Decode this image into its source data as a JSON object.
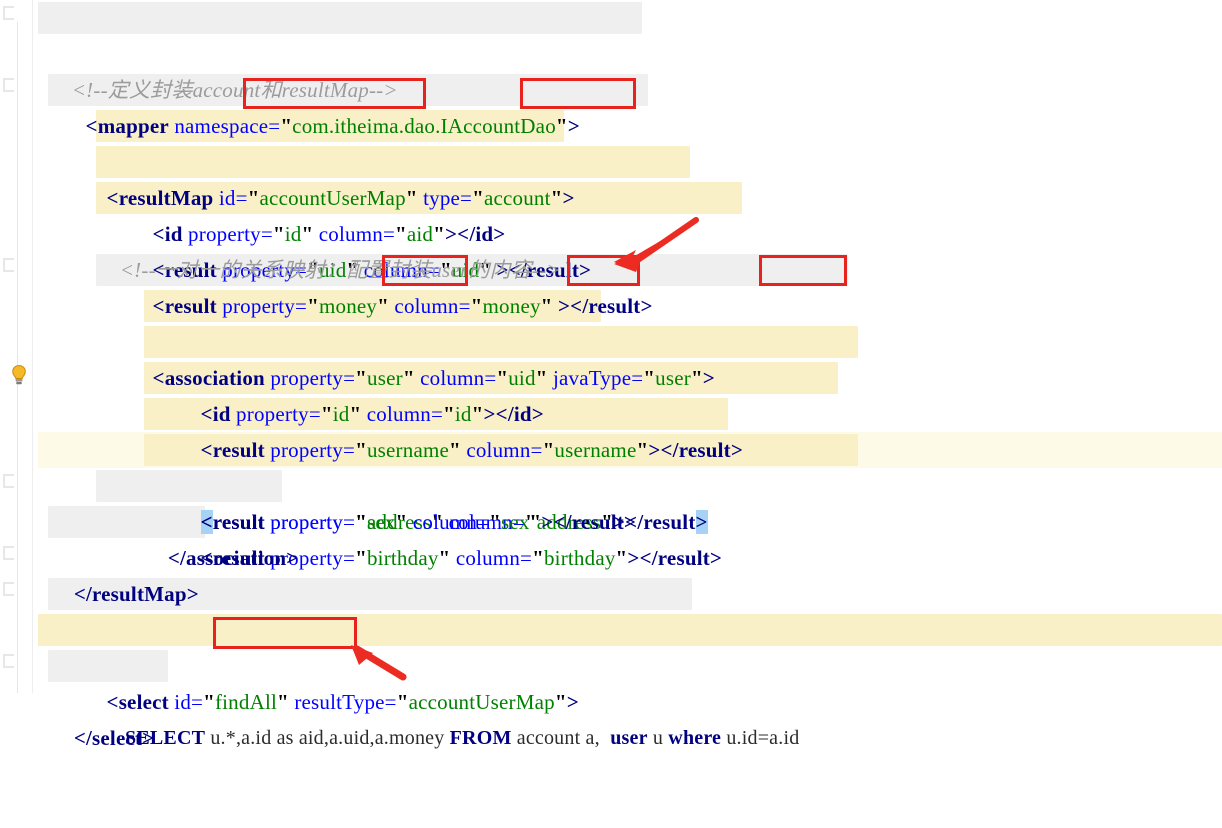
{
  "editor": {
    "language": "xml",
    "file_kind": "MyBatis mapper XML",
    "colors": {
      "background": "#ffffff",
      "tag": "#000080",
      "attribute": "#0000ff",
      "string": "#008000",
      "comment": "#9b9b9b",
      "current_line_band": "#fdfae7",
      "scope_highlight_cream": "#faf0c8",
      "scope_highlight_gray": "#efefef",
      "bracket_match": "#a6d2f5",
      "annotation_red": "#e8231e"
    },
    "gutter": {
      "bulb_icon": "lightbulb-icon",
      "bulb_line_index": 10,
      "fold_marker_icon": "code-fold-marker-icon"
    }
  },
  "lines": [
    {
      "i": 0,
      "text": "<mapper namespace=\"com.itheima.dao.IAccountDao\">"
    },
    {
      "i": 1,
      "text": "<!--定义封装account和resultMap-->"
    },
    {
      "i": 2,
      "text": "<resultMap id=\"accountUserMap\" type=\"account\">"
    },
    {
      "i": 3,
      "text": "<id property=\"id\" column=\"aid\"></id>"
    },
    {
      "i": 4,
      "text": "<result property=\"uid\" column=\"uid\" ></result>"
    },
    {
      "i": 5,
      "text": "<result property=\"money\" column=\"money\" ></result>"
    },
    {
      "i": 6,
      "text": "<!--一对一的关系映射：配置封装user的内容-->"
    },
    {
      "i": 7,
      "text": "<association property=\"user\" column=\"uid\" javaType=\"user\">"
    },
    {
      "i": 8,
      "text": "<id property=\"id\" column=\"id\"></id>"
    },
    {
      "i": 9,
      "text": "<result property=\"username\" column=\"username\"></result>"
    },
    {
      "i": 10,
      "text": "<result property=\"address\" column=\"address\"></result>"
    },
    {
      "i": 11,
      "text": "<result property=\"sex\" column=\"sex\"></result>"
    },
    {
      "i": 12,
      "text": "<result property=\"birthday\" column=\"birthday\"></result>"
    },
    {
      "i": 13,
      "text": "</association>"
    },
    {
      "i": 14,
      "text": "</resultMap>"
    },
    {
      "i": 15,
      "text": ""
    },
    {
      "i": 16,
      "text": "<select id=\"findAll\" resultType=\"accountUserMap\">"
    },
    {
      "i": 17,
      "text": "SELECT u.*,a.id as aid,a.uid,a.money FROM account a,  user u where u.id=a.id"
    },
    {
      "i": 18,
      "text": "</select>"
    }
  ],
  "tokens": {
    "l0": {
      "open": "<",
      "tag": "mapper",
      "attr": " namespace",
      "eq": "=",
      "q1": "\"",
      "val": "com.itheima.dao.IAccountDao",
      "q2": "\"",
      "close": ">"
    },
    "l1": {
      "comment": "<!--定义封装account和resultMap-->"
    },
    "l2": {
      "open": "<",
      "tag": "resultMap",
      "attr1": " id",
      "eq1": "=",
      "q1": "\"",
      "val1": "accountUserMap",
      "q2": "\"",
      "attr2": " type",
      "eq2": "=",
      "q3": "\"",
      "val2": "account",
      "q4": "\"",
      "close": ">"
    },
    "l3": {
      "open": "<",
      "tag": "id",
      "attr1": " property",
      "eq1": "=",
      "q1": "\"",
      "val1": "id",
      "q2": "\"",
      "attr2": " column",
      "eq2": "=",
      "q3": "\"",
      "val2": "aid",
      "q4": "\"",
      "mid": ">",
      "endtag": "</id>"
    },
    "l4": {
      "open": "<",
      "tag": "result",
      "attr1": " property",
      "eq1": "=",
      "q1": "\"",
      "val1": "uid",
      "q2": "\"",
      "attr2": " column",
      "eq2": "=",
      "q3": "\"",
      "val2": "uid",
      "q4": "\"",
      "mid": " >",
      "endtag": "</result>"
    },
    "l5": {
      "open": "<",
      "tag": "result",
      "attr1": " property",
      "eq1": "=",
      "q1": "\"",
      "val1": "money",
      "q2": "\"",
      "attr2": " column",
      "eq2": "=",
      "q3": "\"",
      "val2": "money",
      "q4": "\"",
      "mid": " >",
      "endtag": "</result>"
    },
    "l6": {
      "comment": "<!--一对一的关系映射：配置封装user的内容-->"
    },
    "l7": {
      "open": "<",
      "tag": "association",
      "attr1": " property",
      "eq1": "=",
      "q1": "\"",
      "val1": "user",
      "q2": "\"",
      "attr2": " column",
      "eq2": "=",
      "q3": "\"",
      "val2": "uid",
      "q4": "\"",
      "attr3": " javaType",
      "eq3": "=",
      "q5": "\"",
      "val3": "user",
      "q6": "\"",
      "close": ">"
    },
    "l8": {
      "open": "<",
      "tag": "id",
      "attr1": " property",
      "eq1": "=",
      "q1": "\"",
      "val1": "id",
      "q2": "\"",
      "attr2": " column",
      "eq2": "=",
      "q3": "\"",
      "val2": "id",
      "q4": "\"",
      "mid": ">",
      "endtag": "</id>"
    },
    "l9": {
      "open": "<",
      "tag": "result",
      "attr1": " property",
      "eq1": "=",
      "q1": "\"",
      "val1": "username",
      "q2": "\"",
      "attr2": " column",
      "eq2": "=",
      "q3": "\"",
      "val2": "username",
      "q4": "\"",
      "mid": ">",
      "endtag": "</result>"
    },
    "l10": {
      "open": "<",
      "tag": "result",
      "attr1": " property",
      "eq1": "=",
      "q1": "\"",
      "val1": "address",
      "q2": "\"",
      "attr2": " column",
      "eq2": "=",
      "q3": "\"",
      "val2": "address",
      "q4": "\"",
      "mid": ">",
      "endtag": "</result",
      "endgt": ">"
    },
    "l11": {
      "open": "<",
      "tag": "result",
      "attr1": " property",
      "eq1": "=",
      "q1": "\"",
      "val1": "sex",
      "q2": "\"",
      "attr2": " column",
      "eq2": "=",
      "q3": "\"",
      "val2": "sex",
      "q4": "\"",
      "mid": ">",
      "endtag": "</result>"
    },
    "l12": {
      "open": "<",
      "tag": "result",
      "attr1": " property",
      "eq1": "=",
      "q1": "\"",
      "val1": "birthday",
      "q2": "\"",
      "attr2": " column",
      "eq2": "=",
      "q3": "\"",
      "val2": "birthday",
      "q4": "\"",
      "mid": ">",
      "endtag": "</result>"
    },
    "l13": {
      "endtag": "</association>"
    },
    "l14": {
      "endtag": "</resultMap>"
    },
    "l16": {
      "open": "<",
      "tag": "select",
      "attr1": " id",
      "eq1": "=",
      "q1": "\"",
      "val1": "findAll",
      "q2": "\"",
      "attr2": " resultType",
      "eq2": "=",
      "q3": "\"",
      "val2": "accountUserMap",
      "q4": "\"",
      "close": ">"
    },
    "l17": {
      "kw_select": "SELECT",
      "cols_a": " u.*,",
      "boxed": "a.id as aid,",
      "cols_b": "a.uid,a.money ",
      "kw_from": "FROM",
      "tbl_a": " account a,  ",
      "kw_user": "user",
      "alias_u": " u ",
      "kw_where": "where",
      "cond": " u.id=a.id"
    },
    "l18": {
      "endtag": "</select>"
    }
  },
  "annotations": {
    "boxes": [
      {
        "name": "box-accountusermap-id",
        "target": "accountUserMap"
      },
      {
        "name": "box-account-type",
        "target": "\"account\""
      },
      {
        "name": "box-association-property",
        "target": "\"user\""
      },
      {
        "name": "box-association-column",
        "target": "\"uid\""
      },
      {
        "name": "box-association-javatype",
        "target": "\"user\""
      },
      {
        "name": "box-sql-alias-aid",
        "target": "a.id as aid,"
      }
    ],
    "arrows": [
      {
        "name": "arrow-to-association-column",
        "points_to": "\"uid\"",
        "direction": "down-left"
      },
      {
        "name": "arrow-to-sql-alias",
        "points_to": "a.id as aid,",
        "direction": "up-left"
      }
    ]
  }
}
